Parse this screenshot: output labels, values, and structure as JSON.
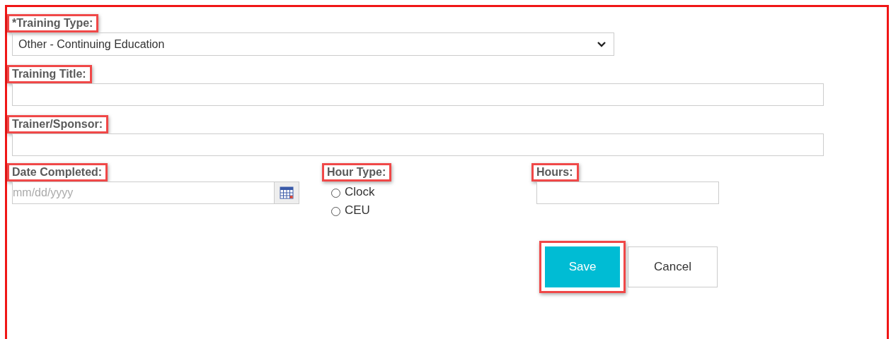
{
  "fields_top": [
    {
      "label": "*Training Type:",
      "highlighted": true,
      "kind": "select",
      "value": "Other - Continuing Education"
    },
    {
      "label": "Training Title:",
      "highlighted": true,
      "kind": "text"
    },
    {
      "label": "Trainer/Sponsor:",
      "highlighted": true,
      "kind": "text"
    }
  ],
  "date_completed": {
    "label": "Date Completed:",
    "highlighted": true,
    "placeholder": "mm/dd/yyyy"
  },
  "hour_type": {
    "label": "Hour Type:",
    "highlighted": true,
    "options": [
      {
        "label": "Clock",
        "selected": false
      },
      {
        "label": "CEU",
        "selected": false
      }
    ]
  },
  "hours": {
    "label": "Hours:",
    "highlighted": true
  },
  "buttons": [
    {
      "label": "Save",
      "kind": "primary",
      "highlighted": true
    },
    {
      "label": "Cancel",
      "kind": "secondary",
      "highlighted": false
    }
  ]
}
